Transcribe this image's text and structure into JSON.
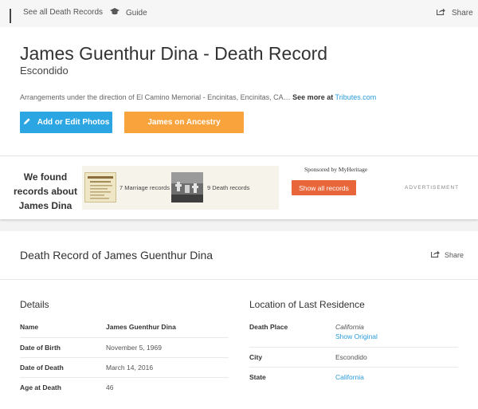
{
  "nav": {
    "see_all": "See all Death Records",
    "guide": "Guide",
    "share": "Share",
    "icons": [
      "grid-icon",
      "graduation-cap-icon",
      "share-icon"
    ]
  },
  "header": {
    "title": "James Guenthur Dina - Death Record",
    "subtitle": "Escondido",
    "arrangements": "Arrangements under the direction of El Camino Memorial - Encinitas, Encinitas, CA…",
    "see_more": "See more at",
    "tributes_link": "Tributes.com",
    "photos_button": "Add or Edit Photos",
    "ancestry_button": "James on Ancestry"
  },
  "ad": {
    "found_text": "We found records about James Dina",
    "marriage_records": "7 Marriage records",
    "death_records": "9 Death records",
    "sponsored": "Sponsored by MyHeritage",
    "show_all": "Show all records",
    "advertisement": "ADVERTISEMENT"
  },
  "record": {
    "title": "Death Record of James Guenthur Dina",
    "share": "Share"
  },
  "details": {
    "heading": "Details",
    "rows": [
      {
        "label": "Name",
        "value": "James Guenthur Dina"
      },
      {
        "label": "Date of Birth",
        "value": "November 5, 1969"
      },
      {
        "label": "Date of Death",
        "value": "March 14, 2016"
      },
      {
        "label": "Age at Death",
        "value": "46"
      }
    ]
  },
  "location": {
    "heading": "Location of Last Residence",
    "death_place_label": "Death Place",
    "death_place_value": "California",
    "show_original": "Show Original",
    "city_label": "City",
    "city_value": "Escondido",
    "state_label": "State",
    "state_value": "California"
  },
  "colors": {
    "blue_button": "#2ba6e2",
    "orange_button": "#f8a33b",
    "show_all_button": "#e8663a",
    "link": "#2a9bd8"
  }
}
